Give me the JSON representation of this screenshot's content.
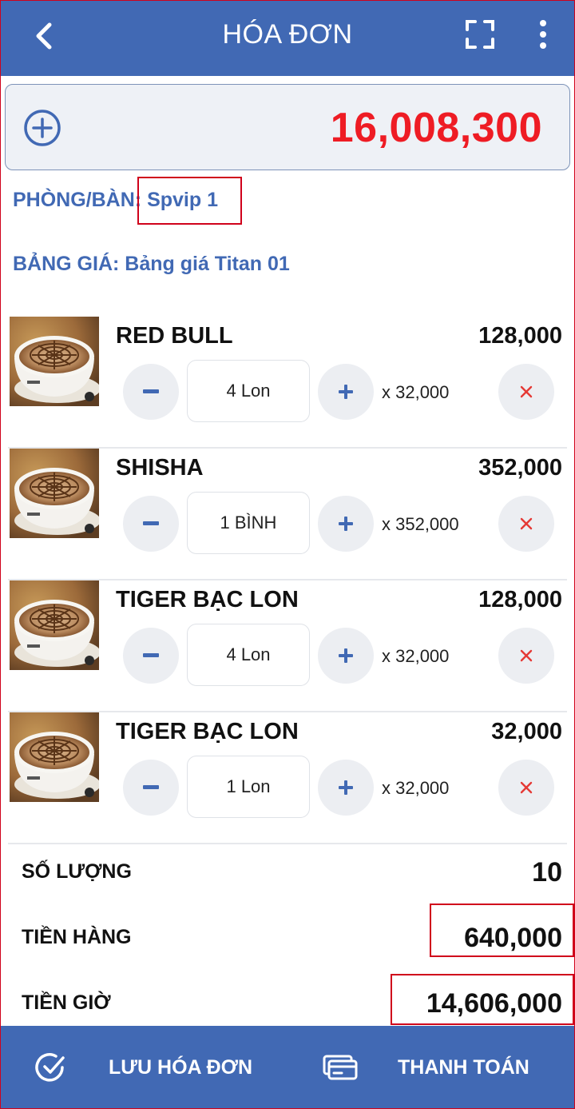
{
  "header": {
    "title": "HÓA ĐƠN",
    "back_icon": "chevron-left-icon",
    "scan_icon": "fullscreen-scan-icon",
    "menu_icon": "more-vertical-icon"
  },
  "order": {
    "total": "16,008,300",
    "add_icon": "plus-circle-icon",
    "room_label": "PHÒNG/BÀN:",
    "room_value": "Spvip 1",
    "price_list_label": "BẢNG GIÁ:",
    "price_list_value": "Bảng giá Titan 01"
  },
  "items": [
    {
      "name": "RED BULL",
      "line_total": "128,000",
      "qty": "4 Lon",
      "unit_price": "x 32,000"
    },
    {
      "name": "SHISHA",
      "line_total": "352,000",
      "qty": "1 BÌNH",
      "unit_price": "x 352,000"
    },
    {
      "name": "TIGER BẠC LON",
      "line_total": "128,000",
      "qty": "4 Lon",
      "unit_price": "x 32,000"
    },
    {
      "name": "TIGER BẠC LON",
      "line_total": "32,000",
      "qty": "1 Lon",
      "unit_price": "x 32,000"
    }
  ],
  "summary": {
    "quantity_label": "SỐ LƯỢNG",
    "quantity_value": "10",
    "goods_label": "TIỀN HÀNG",
    "goods_value": "640,000",
    "time_label": "TIỀN GIỜ",
    "time_value": "14,606,000"
  },
  "footer": {
    "save_label": "LƯU HÓA ĐƠN",
    "pay_label": "THANH TOÁN",
    "save_icon": "check-circle-icon",
    "pay_icon": "card-payment-icon"
  },
  "colors": {
    "primary": "#4169b4",
    "total_red": "#ee1c24",
    "highlight_border": "#d0021b",
    "remove_x": "#e53935"
  }
}
